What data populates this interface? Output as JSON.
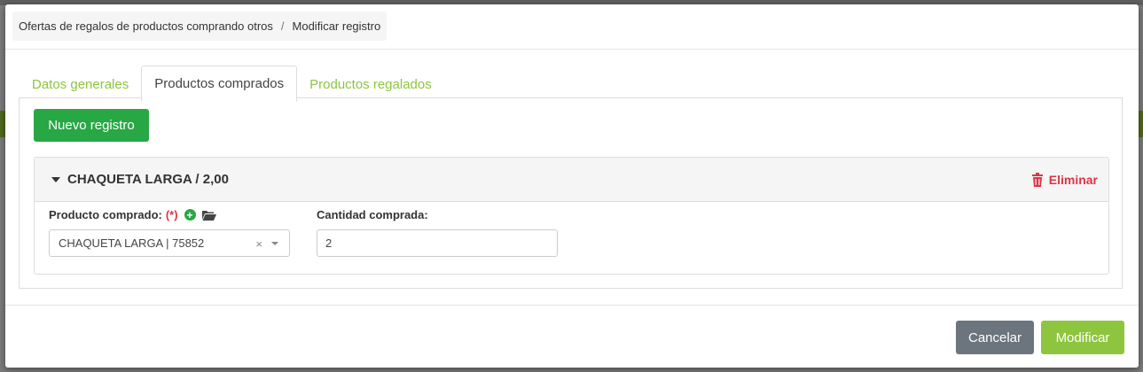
{
  "breadcrumb": {
    "parent": "Ofertas de regalos de productos comprando otros",
    "separator": "/",
    "current": "Modificar registro"
  },
  "tabs": [
    {
      "label": "Datos generales",
      "active": false
    },
    {
      "label": "Productos comprados",
      "active": true
    },
    {
      "label": "Productos regalados",
      "active": false
    }
  ],
  "panel": {
    "new_button": "Nuevo registro",
    "record": {
      "title": "CHAQUETA LARGA / 2,00",
      "delete_label": "Eliminar",
      "product_label": "Producto comprado:",
      "required_mark": "(*)",
      "product_value": "CHAQUETA LARGA | 75852",
      "clear_glyph": "×",
      "qty_label": "Cantidad comprada:",
      "qty_value": "2"
    }
  },
  "footer": {
    "cancel_label": "Cancelar",
    "submit_label": "Modificar"
  },
  "icons": {
    "add": "plus-circle-icon",
    "browse": "folder-open-icon",
    "delete": "trash-icon",
    "collapse": "caret-down-icon"
  },
  "colors": {
    "accent_green": "#8dc53e",
    "success_green": "#28a745",
    "danger_red": "#dc3545",
    "secondary_gray": "#6c757d"
  }
}
